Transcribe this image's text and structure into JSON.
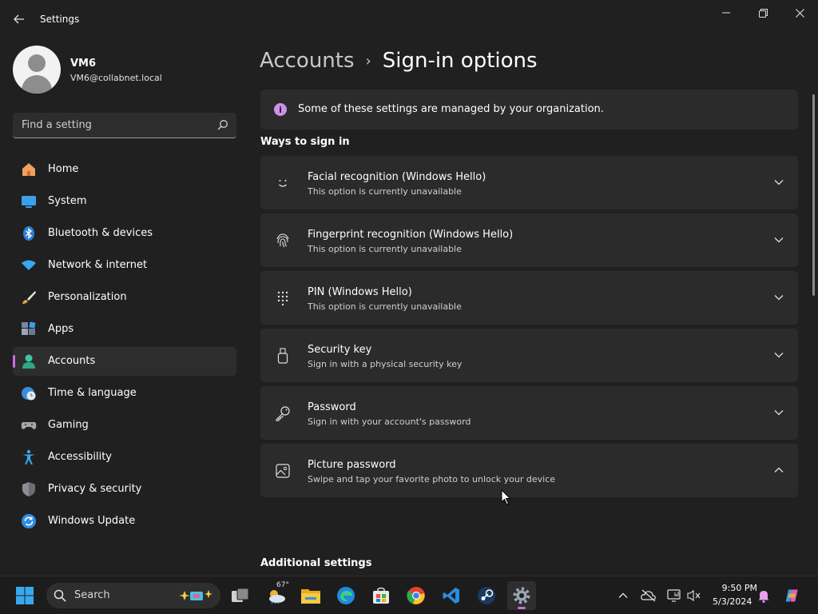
{
  "window": {
    "title": "Settings"
  },
  "profile": {
    "name": "VM6",
    "email": "VM6@collabnet.local"
  },
  "search": {
    "placeholder": "Find a setting"
  },
  "nav": {
    "items": [
      {
        "label": "Home",
        "icon": "home-icon"
      },
      {
        "label": "System",
        "icon": "system-icon"
      },
      {
        "label": "Bluetooth & devices",
        "icon": "bluetooth-icon"
      },
      {
        "label": "Network & internet",
        "icon": "wifi-icon"
      },
      {
        "label": "Personalization",
        "icon": "brush-icon"
      },
      {
        "label": "Apps",
        "icon": "apps-icon"
      },
      {
        "label": "Accounts",
        "icon": "accounts-icon",
        "active": true
      },
      {
        "label": "Time & language",
        "icon": "clock-globe-icon"
      },
      {
        "label": "Gaming",
        "icon": "gamepad-icon"
      },
      {
        "label": "Accessibility",
        "icon": "accessibility-icon"
      },
      {
        "label": "Privacy & security",
        "icon": "shield-icon"
      },
      {
        "label": "Windows Update",
        "icon": "update-icon"
      }
    ]
  },
  "breadcrumb": {
    "parent": "Accounts",
    "current": "Sign-in options"
  },
  "info": {
    "text": "Some of these settings are managed by your organization."
  },
  "sections": {
    "ways": "Ways to sign in",
    "additional": "Additional settings"
  },
  "sign_in_options": [
    {
      "title": "Facial recognition (Windows Hello)",
      "subtitle": "This option is currently unavailable",
      "icon": "face-icon",
      "expanded": false
    },
    {
      "title": "Fingerprint recognition (Windows Hello)",
      "subtitle": "This option is currently unavailable",
      "icon": "fingerprint-icon",
      "expanded": false
    },
    {
      "title": "PIN (Windows Hello)",
      "subtitle": "This option is currently unavailable",
      "icon": "pin-keypad-icon",
      "expanded": false
    },
    {
      "title": "Security key",
      "subtitle": "Sign in with a physical security key",
      "icon": "usb-key-icon",
      "expanded": false
    },
    {
      "title": "Password",
      "subtitle": "Sign in with your account's password",
      "icon": "key-icon",
      "expanded": false
    },
    {
      "title": "Picture password",
      "subtitle": "Swipe and tap your favorite photo to unlock your device",
      "icon": "picture-icon",
      "expanded": true
    }
  ],
  "taskbar": {
    "search_label": "Search",
    "weather_temp": "67°",
    "time": "9:50 PM",
    "date": "5/3/2024",
    "apps": [
      "task-view-icon",
      "weather-icon",
      "file-explorer-icon",
      "edge-icon",
      "store-icon",
      "chrome-icon",
      "vscode-icon",
      "steam-icon",
      "settings-gear-icon"
    ],
    "active_app": "settings-gear-icon"
  },
  "colors": {
    "background": "#202020",
    "card": "#2b2b2b",
    "accent": "#c86ee0",
    "info_icon": "#d08fe6"
  }
}
